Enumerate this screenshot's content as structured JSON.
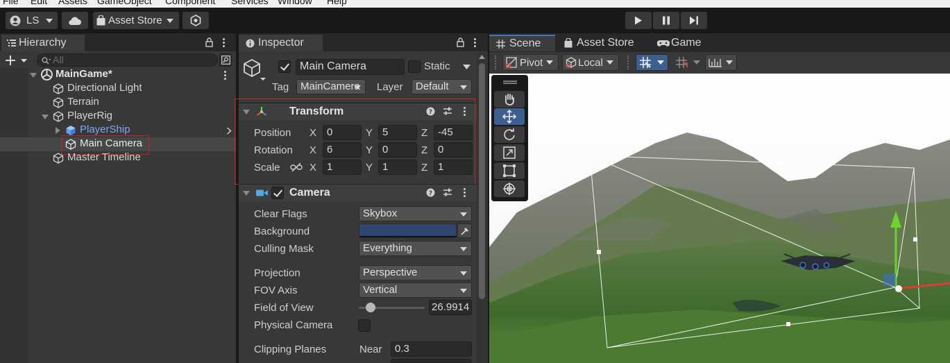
{
  "menu": [
    "File",
    "Edit",
    "Assets",
    "GameObject",
    "Component",
    "Services",
    "Window",
    "Help"
  ],
  "toolbar": {
    "account_label": "LS",
    "asset_store_label": "Asset Store"
  },
  "hierarchy": {
    "tab_label": "Hierarchy",
    "search_placeholder": "All",
    "scene_name": "MainGame*",
    "items": [
      {
        "label": "Directional Light"
      },
      {
        "label": "Terrain"
      },
      {
        "label": "PlayerRig"
      },
      {
        "label": "PlayerShip"
      },
      {
        "label": "Main Camera"
      },
      {
        "label": "Master Timeline"
      }
    ]
  },
  "inspector": {
    "tab_label": "Inspector",
    "object_name": "Main Camera",
    "static_label": "Static",
    "tag_label": "Tag",
    "tag_value": "MainCamera",
    "layer_label": "Layer",
    "layer_value": "Default",
    "transform": {
      "title": "Transform",
      "position_label": "Position",
      "rotation_label": "Rotation",
      "scale_label": "Scale",
      "axis_x": "X",
      "axis_y": "Y",
      "axis_z": "Z",
      "position": {
        "x": "0",
        "y": "5",
        "z": "-45"
      },
      "rotation": {
        "x": "6",
        "y": "0",
        "z": "0"
      },
      "scale": {
        "x": "1",
        "y": "1",
        "z": "1"
      }
    },
    "camera": {
      "title": "Camera",
      "clear_flags_label": "Clear Flags",
      "clear_flags_value": "Skybox",
      "background_label": "Background",
      "background_color": "#31466f",
      "culling_mask_label": "Culling Mask",
      "culling_mask_value": "Everything",
      "projection_label": "Projection",
      "projection_value": "Perspective",
      "fov_axis_label": "FOV Axis",
      "fov_axis_value": "Vertical",
      "fov_label": "Field of View",
      "fov_value": "26.9914",
      "fov_slider_fraction": 0.1,
      "physical_camera_label": "Physical Camera",
      "clipping_planes_label": "Clipping Planes",
      "near_label": "Near",
      "near_value": "0.3"
    }
  },
  "scene": {
    "tabs": [
      {
        "label": "Scene"
      },
      {
        "label": "Asset Store"
      },
      {
        "label": "Game"
      }
    ],
    "pivot_label": "Pivot",
    "local_label": "Local"
  },
  "colors": {
    "accent_blue": "#3d5f8f",
    "highlight_red": "#c8202a",
    "prefab_blue": "#7aaaf0"
  }
}
